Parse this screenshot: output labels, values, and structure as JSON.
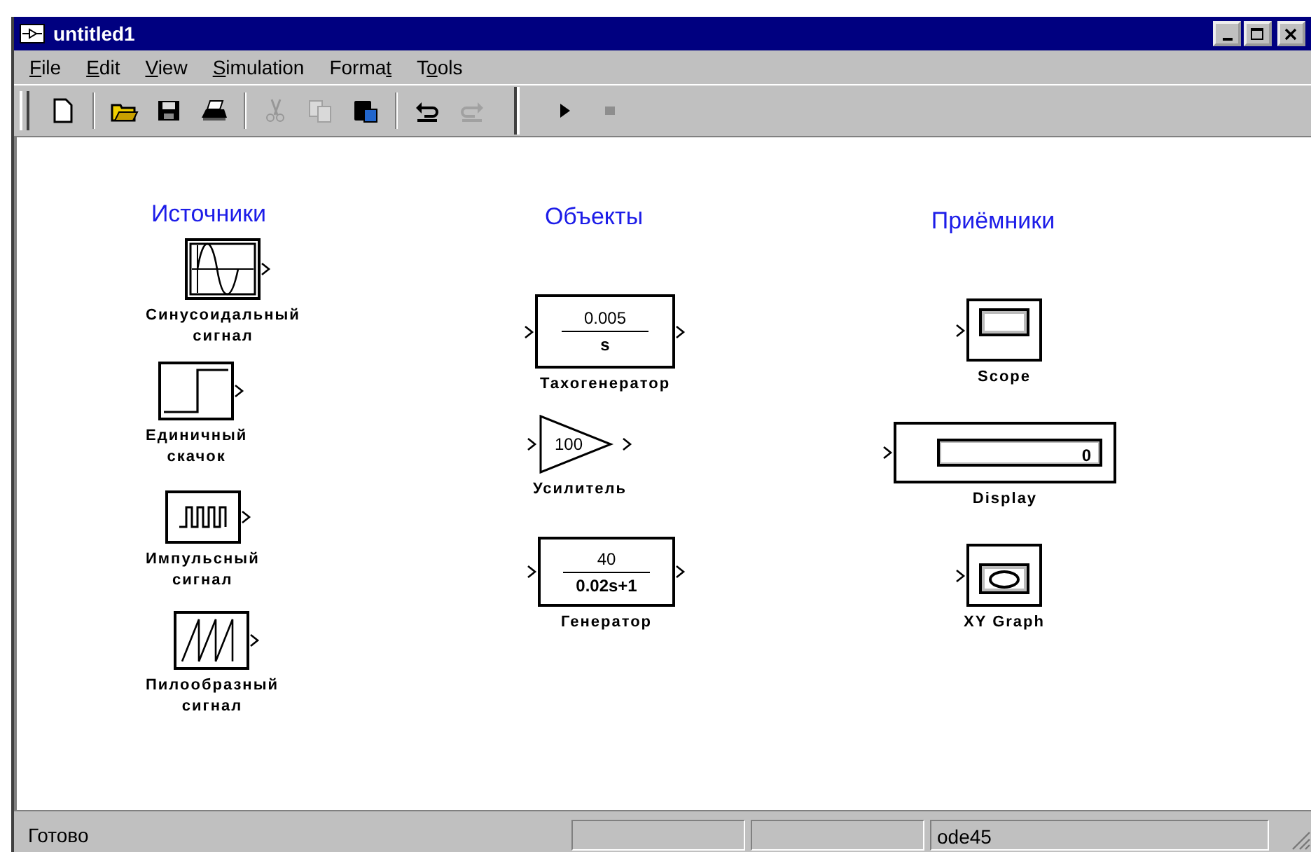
{
  "window": {
    "title": "untitled1"
  },
  "menu": [
    {
      "accel": "F",
      "rest": "ile"
    },
    {
      "accel": "E",
      "rest": "dit"
    },
    {
      "accel": "V",
      "rest": "iew"
    },
    {
      "accel": "S",
      "rest": "imulation"
    },
    {
      "text": "Forma",
      "accel": "t"
    },
    {
      "text": "T",
      "accel": "o",
      "rest": "ols"
    }
  ],
  "toolbar": [
    {
      "kind": "new",
      "disabled": false
    },
    {
      "kind": "separator"
    },
    {
      "kind": "open",
      "disabled": false
    },
    {
      "kind": "save",
      "disabled": false
    },
    {
      "kind": "print",
      "disabled": false
    },
    {
      "kind": "separator"
    },
    {
      "kind": "cut",
      "disabled": true
    },
    {
      "kind": "copy",
      "disabled": true
    },
    {
      "kind": "paste",
      "disabled": false
    },
    {
      "kind": "separator"
    },
    {
      "kind": "undo",
      "disabled": false
    },
    {
      "kind": "redo",
      "disabled": true
    },
    {
      "kind": "bigseparator"
    },
    {
      "kind": "play",
      "disabled": false
    },
    {
      "kind": "stop",
      "disabled": true
    }
  ],
  "columns": [
    {
      "heading": "Источники",
      "blocks": [
        {
          "kind": "sine",
          "label": "Синусоидальный\nсигнал"
        },
        {
          "kind": "step",
          "label": "Единичный\nскачок"
        },
        {
          "kind": "pulse",
          "label": "Импульсный\nсигнал"
        },
        {
          "kind": "sawtooth",
          "label": "Пилообразный\nсигнал"
        }
      ]
    },
    {
      "heading": "Объекты",
      "blocks": [
        {
          "kind": "transfer",
          "numerator": "0.005",
          "denominator": "s",
          "label": "Тахогенератор"
        },
        {
          "kind": "gain",
          "value": "100",
          "label": "Усилитель"
        },
        {
          "kind": "transfer",
          "numerator": "40",
          "denominator": "0.02s+1",
          "label": "Генератор"
        }
      ]
    },
    {
      "heading": "Приёмники",
      "blocks": [
        {
          "kind": "scope",
          "label": "Scope"
        },
        {
          "kind": "display",
          "value": "0",
          "label": "Display"
        },
        {
          "kind": "xygraph",
          "label": "XY Graph"
        }
      ]
    }
  ],
  "status_bar": {
    "message": "Готово",
    "solver": "ode45"
  }
}
